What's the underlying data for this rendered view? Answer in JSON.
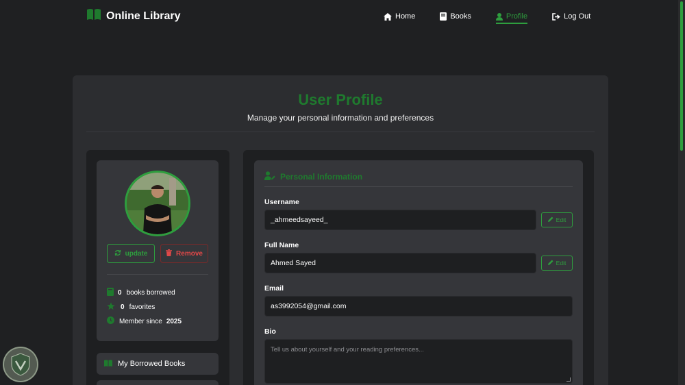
{
  "navbar": {
    "brand": "Online Library",
    "links": [
      {
        "label": "Home",
        "icon": "home-icon"
      },
      {
        "label": "Books",
        "icon": "book-icon"
      },
      {
        "label": "Profile",
        "icon": "user-icon",
        "active": true
      },
      {
        "label": "Log Out",
        "icon": "logout-icon"
      }
    ]
  },
  "header": {
    "title": "User Profile",
    "subtitle": "Manage your personal information and preferences"
  },
  "profile_card": {
    "update_label": "update",
    "remove_label": "Remove",
    "stats": {
      "books_count": "0",
      "books_label": "books borrowed",
      "favorites_count": "0",
      "favorites_label": "favorites",
      "member_label": "Member since",
      "member_year": "2025"
    }
  },
  "side_links": [
    {
      "label": "My Borrowed Books",
      "icon": "books-icon"
    },
    {
      "label": "",
      "icon": ""
    }
  ],
  "personal_info": {
    "title": "Personal Information",
    "username_label": "Username",
    "username_value": "_ahmeedsayeed_",
    "fullname_label": "Full Name",
    "fullname_value": "Ahmed Sayed",
    "email_label": "Email",
    "email_value": "as3992054@gmail.com",
    "bio_label": "Bio",
    "bio_placeholder": "Tell us about yourself and your reading preferences...",
    "edit_label": "Edit"
  },
  "colors": {
    "accent": "#2e9e3e",
    "title_green": "#1f7a2e",
    "danger": "#e04848",
    "background": "#1f2022",
    "card": "#2c2d30",
    "panel": "#35363a"
  }
}
